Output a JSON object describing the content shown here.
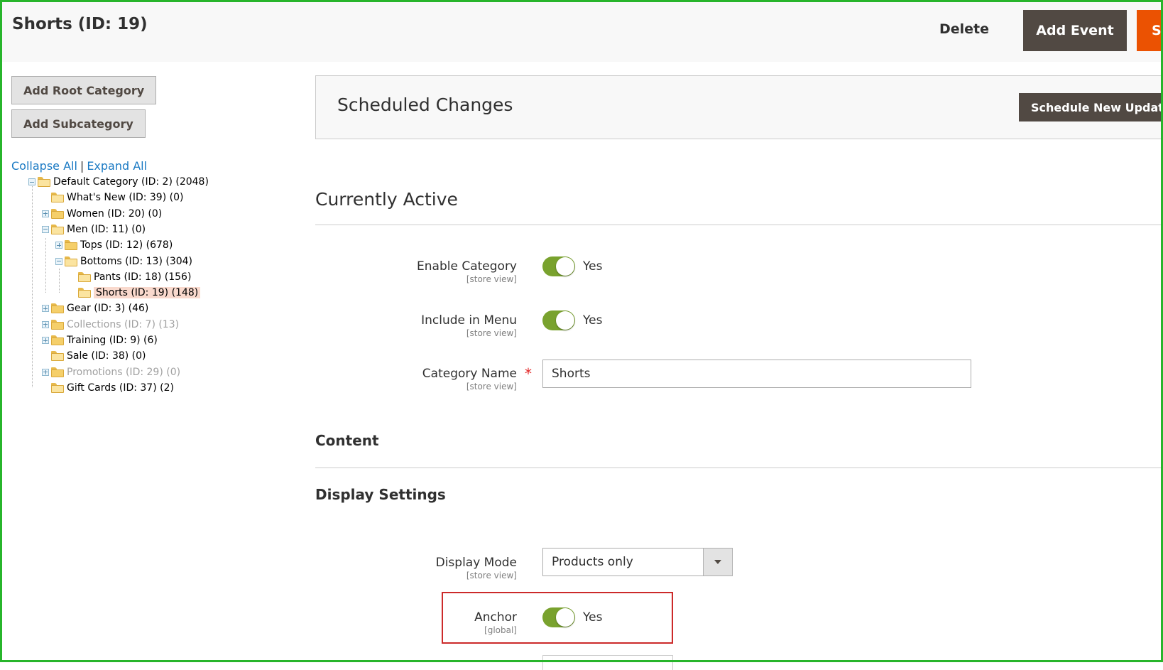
{
  "header": {
    "title": "Shorts (ID: 19)",
    "delete_label": "Delete",
    "add_event_label": "Add Event",
    "save_label": "Sa"
  },
  "sidebar": {
    "add_root_label": "Add Root Category",
    "add_sub_label": "Add Subcategory",
    "collapse_all": "Collapse All",
    "separator": "|",
    "expand_all": "Expand All",
    "tree": [
      {
        "label": "Default Category (ID: 2) (2048)",
        "toggle": "minus",
        "muted": false,
        "selected": false
      },
      {
        "label": "What's New (ID: 39) (0)",
        "toggle": "none",
        "muted": false,
        "selected": false
      },
      {
        "label": "Women (ID: 20) (0)",
        "toggle": "plus",
        "muted": false,
        "selected": false
      },
      {
        "label": "Men (ID: 11) (0)",
        "toggle": "minus",
        "muted": false,
        "selected": false
      },
      {
        "label": "Tops (ID: 12) (678)",
        "toggle": "plus",
        "muted": false,
        "selected": false
      },
      {
        "label": "Bottoms (ID: 13) (304)",
        "toggle": "minus",
        "muted": false,
        "selected": false
      },
      {
        "label": "Pants (ID: 18) (156)",
        "toggle": "none",
        "muted": false,
        "selected": false
      },
      {
        "label": "Shorts (ID: 19) (148)",
        "toggle": "none",
        "muted": false,
        "selected": true
      },
      {
        "label": "Gear (ID: 3) (46)",
        "toggle": "plus",
        "muted": false,
        "selected": false
      },
      {
        "label": "Collections (ID: 7) (13)",
        "toggle": "plus",
        "muted": true,
        "selected": false
      },
      {
        "label": "Training (ID: 9) (6)",
        "toggle": "plus",
        "muted": false,
        "selected": false
      },
      {
        "label": "Sale (ID: 38) (0)",
        "toggle": "none",
        "muted": false,
        "selected": false
      },
      {
        "label": "Promotions (ID: 29) (0)",
        "toggle": "plus",
        "muted": true,
        "selected": false
      },
      {
        "label": "Gift Cards (ID: 37) (2)",
        "toggle": "none",
        "muted": false,
        "selected": false
      }
    ]
  },
  "scheduled": {
    "title": "Scheduled Changes",
    "button_label": "Schedule New Update"
  },
  "currently_active": {
    "title": "Currently Active",
    "enable_category": {
      "label": "Enable Category",
      "scope": "[store view]",
      "value": "Yes"
    },
    "include_in_menu": {
      "label": "Include in Menu",
      "scope": "[store view]",
      "value": "Yes"
    },
    "category_name": {
      "label": "Category Name",
      "scope": "[store view]",
      "required_mark": "*",
      "value": "Shorts"
    }
  },
  "content": {
    "title": "Content"
  },
  "display_settings": {
    "title": "Display Settings",
    "display_mode": {
      "label": "Display Mode",
      "scope": "[store view]",
      "value": "Products only"
    },
    "anchor": {
      "label": "Anchor",
      "scope": "[global]",
      "value": "Yes"
    }
  },
  "colors": {
    "accent_orange": "#eb5202",
    "dark_button": "#514943",
    "switch_on": "#79a22e",
    "link": "#1979c3",
    "highlight_red": "#cc2a2a",
    "frame_green": "#27b52b"
  }
}
